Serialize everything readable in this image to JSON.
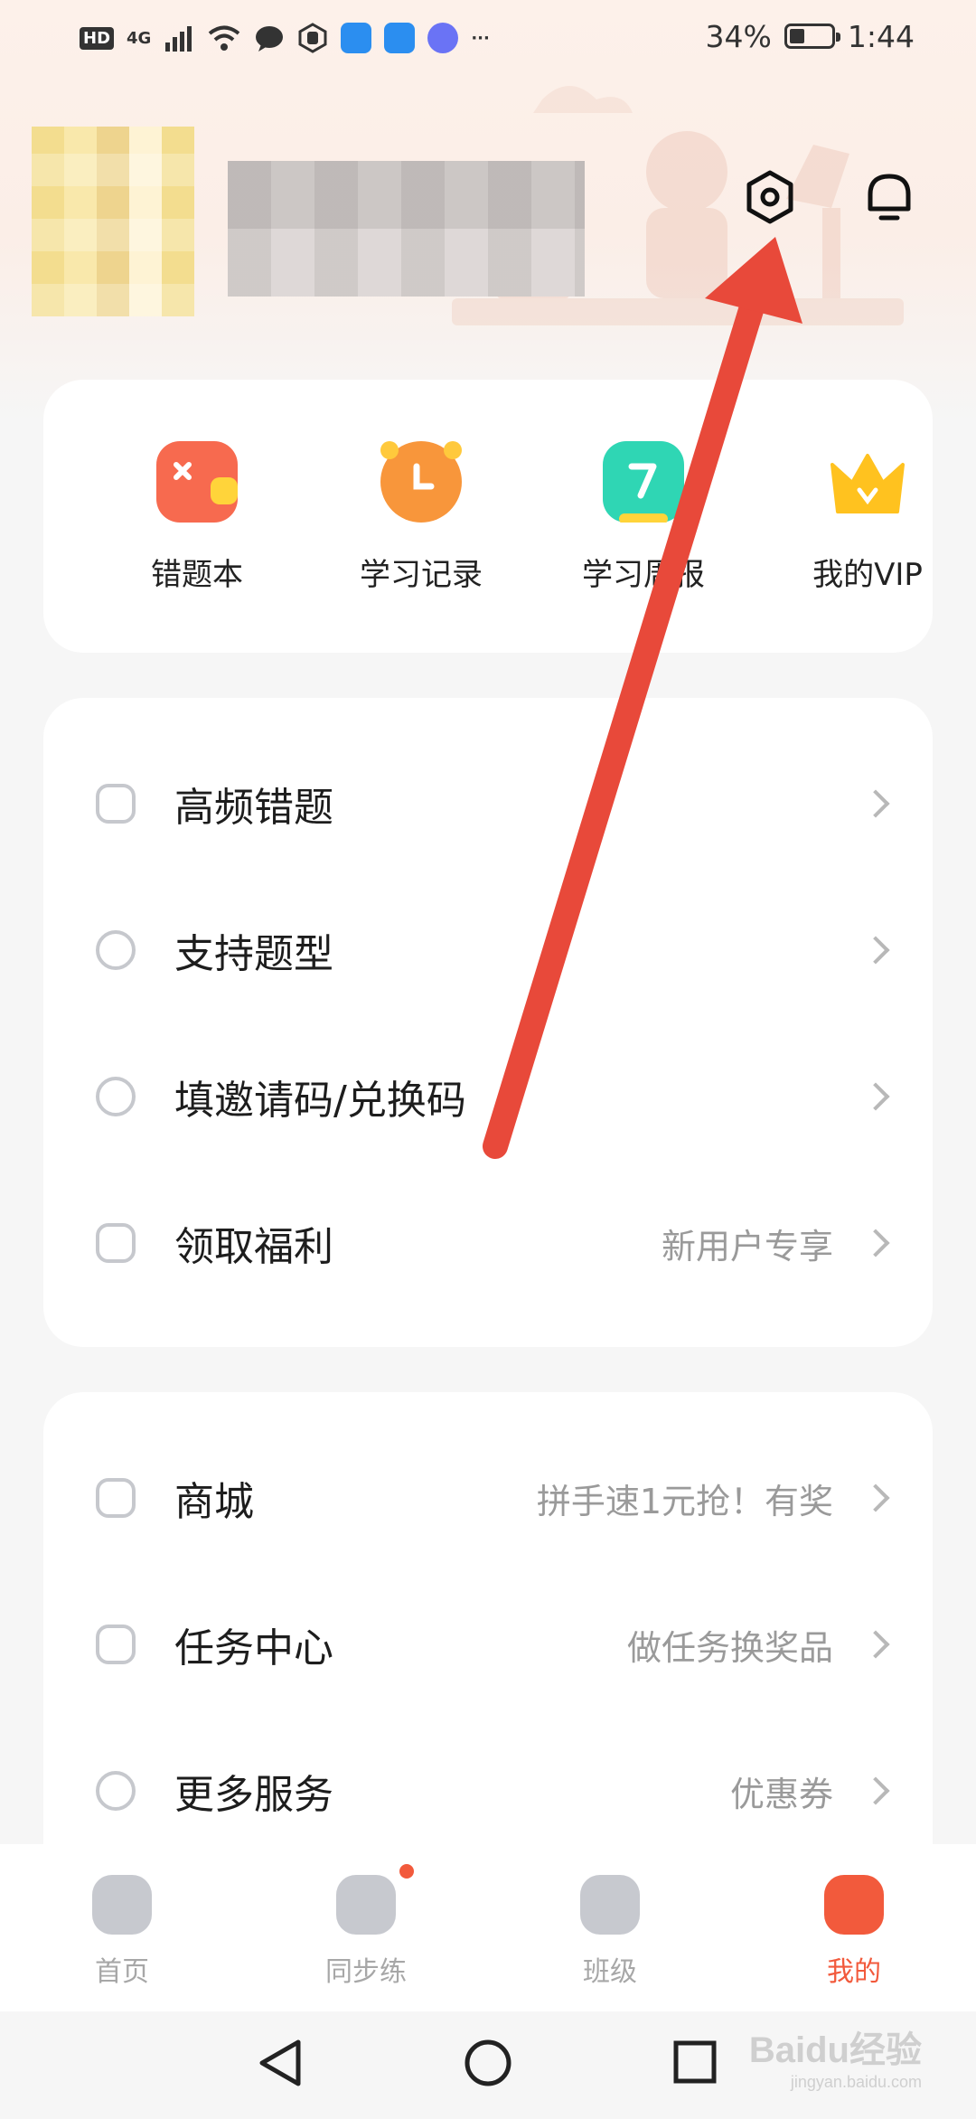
{
  "status_bar": {
    "hd_badge": "HD",
    "network": "4G",
    "more": "···",
    "battery": "34%",
    "time": "1:44"
  },
  "quick_actions": [
    {
      "label": "错题本",
      "icon": "wrong-book-icon"
    },
    {
      "label": "学习记录",
      "icon": "clock-icon"
    },
    {
      "label": "学习周报",
      "icon": "weekly-report-icon"
    },
    {
      "label": "我的VIP",
      "icon": "crown-icon"
    }
  ],
  "menu_group_1": [
    {
      "label": "高频错题",
      "sub": "",
      "icon": "x-box-icon"
    },
    {
      "label": "支持题型",
      "sub": "",
      "icon": "tag-icon"
    },
    {
      "label": "填邀请码/兑换码",
      "sub": "",
      "icon": "ticket-icon"
    },
    {
      "label": "领取福利",
      "sub": "新用户专享",
      "icon": "gift-icon"
    }
  ],
  "menu_group_2": [
    {
      "label": "商城",
      "sub": "拼手速1元抢！有奖",
      "icon": "shop-bag-icon"
    },
    {
      "label": "任务中心",
      "sub": "做任务换奖品",
      "icon": "check-box-icon"
    },
    {
      "label": "更多服务",
      "sub": "优惠券",
      "icon": "heart-icon"
    }
  ],
  "bottom_nav": [
    {
      "label": "首页",
      "active": false
    },
    {
      "label": "同步练",
      "active": false
    },
    {
      "label": "班级",
      "active": false
    },
    {
      "label": "我的",
      "active": true
    }
  ],
  "watermark": {
    "brand": "Baidu经验",
    "url": "jingyan.baidu.com"
  },
  "colors": {
    "accent": "#f25a3c",
    "arrow": "#e8493a",
    "card_bg": "#ffffff",
    "page_bg": "#f6f6f6"
  }
}
